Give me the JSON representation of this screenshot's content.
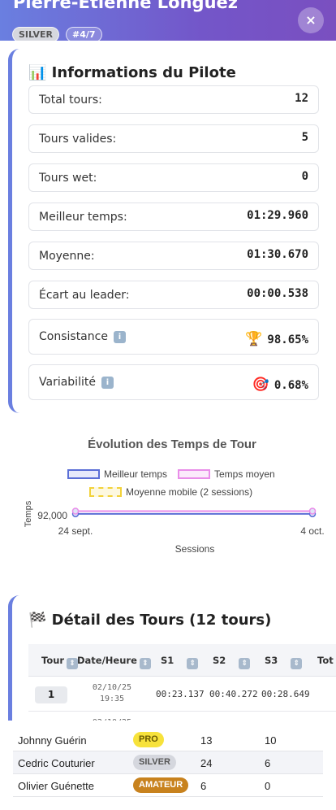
{
  "header": {
    "pilot_name": "Pierre-Étienne Longuez",
    "level_badge": "SILVER",
    "rank_badge": "#4/7",
    "close_label": "×"
  },
  "info": {
    "title": "📊 Informations du Pilote",
    "stats": [
      {
        "label": "Total tours:",
        "value": "12"
      },
      {
        "label": "Tours valides:",
        "value": "5"
      },
      {
        "label": "Tours wet:",
        "value": "0"
      },
      {
        "label": "Meilleur temps:",
        "value": "01:29.960"
      },
      {
        "label": "Moyenne:",
        "value": "01:30.670"
      },
      {
        "label": "Écart au leader:",
        "value": "00:00.538"
      }
    ],
    "consistance": {
      "label": "Consistance",
      "info": "i",
      "icon": "🏆",
      "value": "98.65%"
    },
    "variabilite": {
      "label": "Variabilité",
      "info": "i",
      "icon": "🎯",
      "value": "0.68%"
    }
  },
  "chart_data": {
    "type": "line",
    "title": "Évolution des Temps de Tour",
    "xlabel": "Sessions",
    "ylabel": "Temps",
    "x": [
      "24 sept.",
      "4 oct."
    ],
    "ytick": "92,000",
    "series": [
      {
        "name": "Meilleur temps",
        "values": [
          89.96,
          89.96
        ],
        "color": "#5b6fd6"
      },
      {
        "name": "Temps moyen",
        "values": [
          90.67,
          90.67
        ],
        "color": "#e98de9"
      },
      {
        "name": "Moyenne mobile (2 sessions)",
        "values": [],
        "color": "#f2d23a"
      }
    ],
    "legend": "top",
    "grid": false
  },
  "laps": {
    "title": "🏁 Détail des Tours (12 tours)",
    "sort_icon": "⇕",
    "columns": [
      "Tour",
      "Date/Heure",
      "S1",
      "S2",
      "S3",
      "Tot"
    ],
    "rows": [
      {
        "lap": "1",
        "date": "02/10/25",
        "time": "19:35",
        "s1": "00:23.137",
        "s2": "00:40.272",
        "s3": "00:28.649"
      },
      {
        "lap": "",
        "date": "02/10/25",
        "time": "",
        "s1": "",
        "s2": "",
        "s3": ""
      }
    ]
  },
  "ranking": [
    {
      "name": "Johnny Guérin",
      "level": "PRO",
      "level_bg": "#f7e23b",
      "level_fg": "#6a5a00",
      "c1": "13",
      "c2": "10"
    },
    {
      "name": "Cedric Couturier",
      "level": "SILVER",
      "level_bg": "#d5d7de",
      "level_fg": "#555555",
      "c1": "24",
      "c2": "6"
    },
    {
      "name": "Olivier Guénette",
      "level": "AMATEUR",
      "level_bg": "#c8821e",
      "level_fg": "#ffffff",
      "c1": "6",
      "c2": "0"
    }
  ]
}
